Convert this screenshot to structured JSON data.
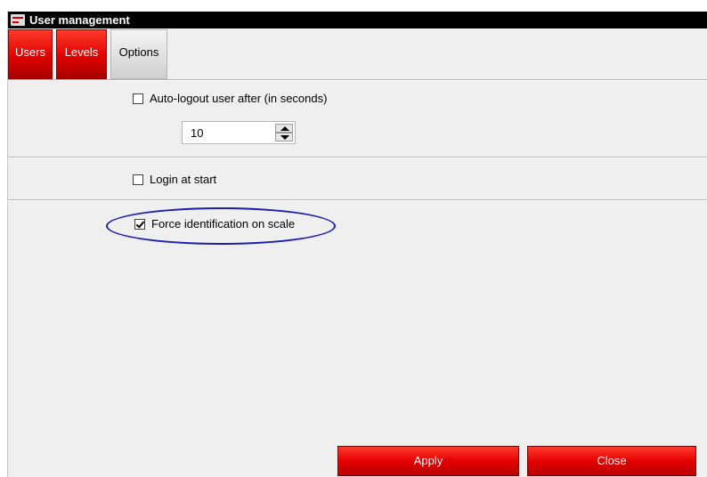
{
  "window": {
    "title": "User management",
    "icon": "app-logo-icon"
  },
  "tabs": [
    {
      "label": "Users",
      "active": false
    },
    {
      "label": "Levels",
      "active": false
    },
    {
      "label": "Options",
      "active": true
    }
  ],
  "options": {
    "auto_logout": {
      "label": "Auto-logout user after (in seconds)",
      "checked": false,
      "seconds_value": "10"
    },
    "login_at_start": {
      "label": "Login at start",
      "checked": false
    },
    "force_identification": {
      "label": "Force identification on scale",
      "checked": true
    }
  },
  "buttons": {
    "apply": "Apply",
    "close": "Close"
  },
  "colors": {
    "accent_red": "#e00000",
    "highlight_blue": "#1c1cb0",
    "titlebar": "#000000",
    "panel_bg": "#efefef"
  }
}
